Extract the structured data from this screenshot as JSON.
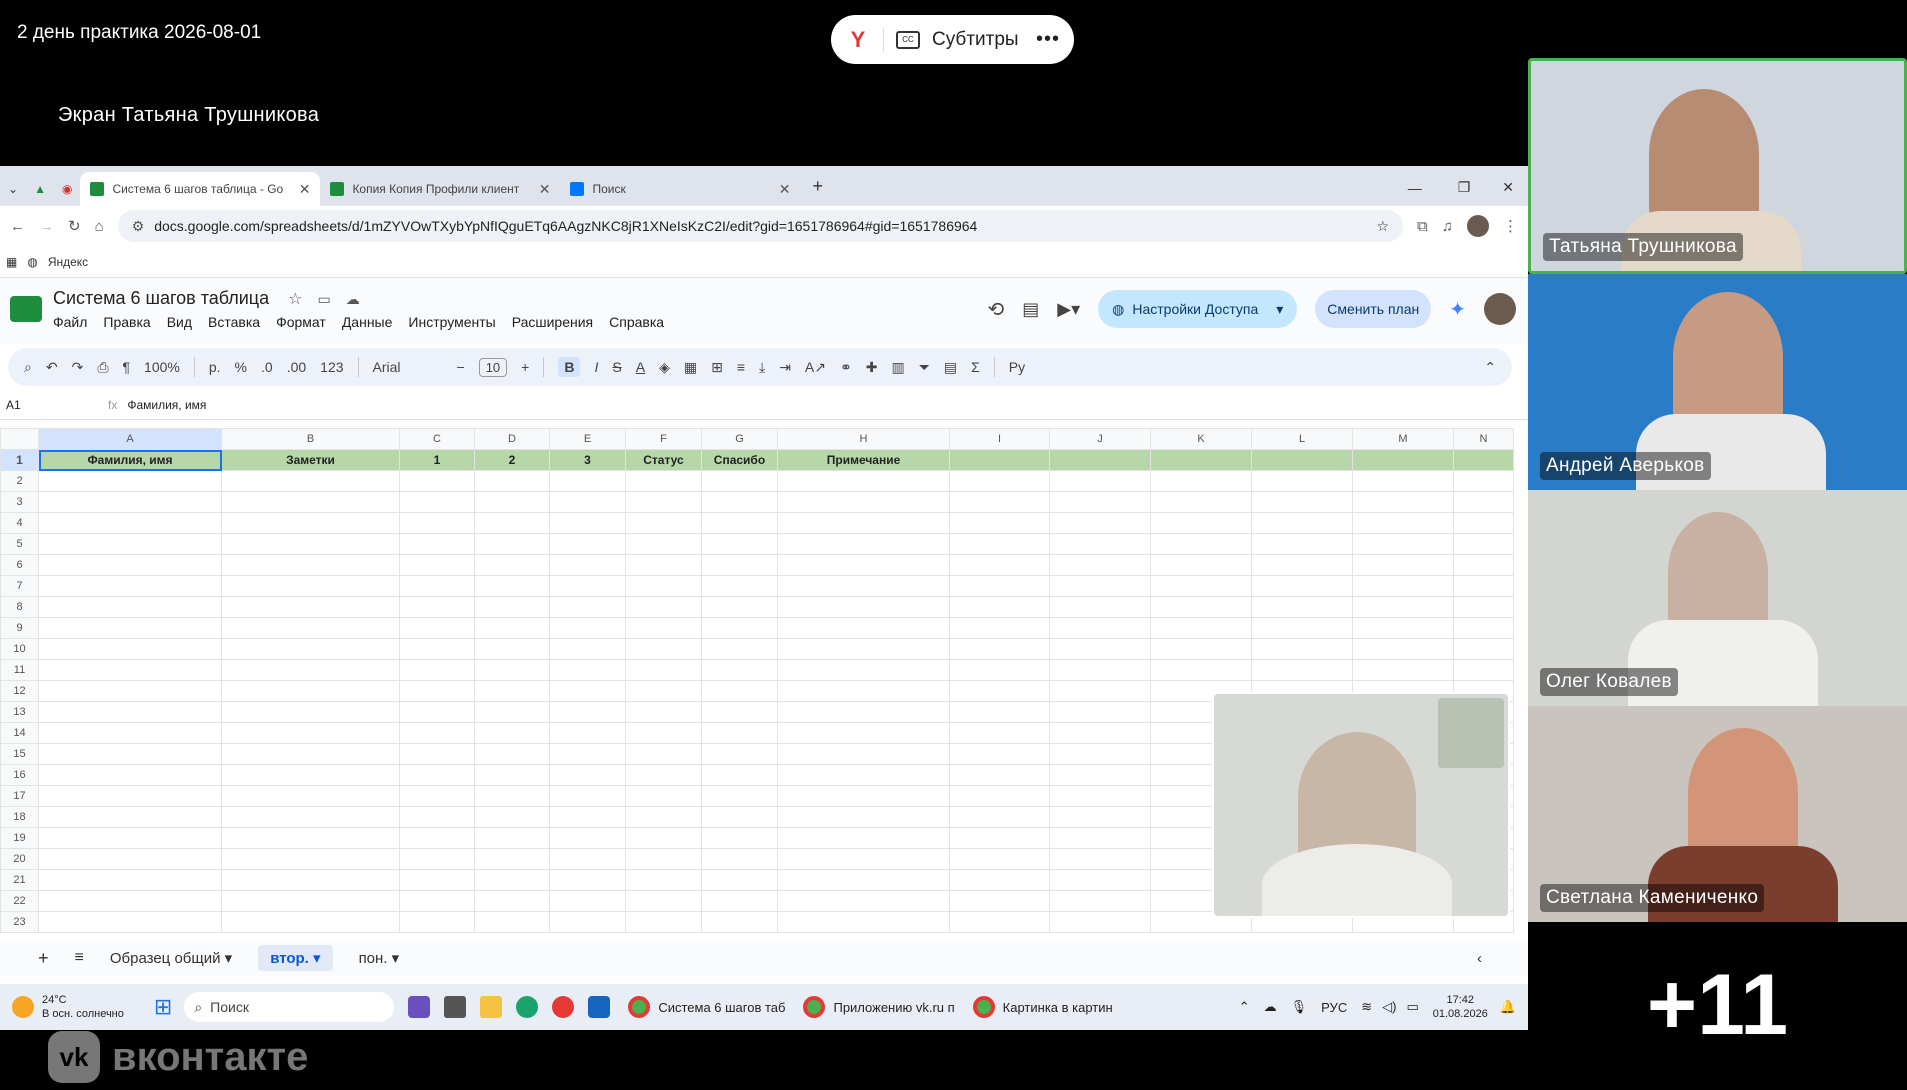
{
  "meeting": {
    "title": "2 день практика 2026-08-01",
    "screen_owner": "Экран Татьяна Трушникова",
    "subtitles_label": "Субтитры",
    "more_participants": "+11"
  },
  "browser": {
    "tabs": [
      {
        "label": "Система 6 шагов таблица - Go",
        "active": true
      },
      {
        "label": "Копия Копия Профили клиент",
        "active": false
      },
      {
        "label": "Поиск",
        "active": false
      }
    ],
    "url": "docs.google.com/spreadsheets/d/1mZYVOwTXybYpNfIQguETq6AAgzNKC8jR1XNeIsKzC2I/edit?gid=1651786964#gid=1651786964",
    "bookmark": "Яндекс"
  },
  "sheet": {
    "title": "Система 6 шагов таблица",
    "menus": [
      "Файл",
      "Правка",
      "Вид",
      "Вставка",
      "Формат",
      "Данные",
      "Инструменты",
      "Расширения",
      "Справка"
    ],
    "share_label": "Настройки Доступа",
    "plan_label": "Сменить план",
    "zoom": "100%",
    "currency": "р.",
    "percent": "%",
    "dec_less": ".0",
    "dec_more": ".00",
    "num_format": "123",
    "font": "Arial",
    "font_size": "10",
    "cell_ref": "A1",
    "formula_value": "Фамилия, имя",
    "columns": [
      "A",
      "B",
      "C",
      "D",
      "E",
      "F",
      "G",
      "H",
      "I",
      "J",
      "K",
      "L",
      "M",
      "N"
    ],
    "header_row": [
      "Фамилия, имя",
      "Заметки",
      "1",
      "2",
      "3",
      "Статус",
      "Спасибо",
      "Примечание",
      "",
      "",
      "",
      "",
      "",
      ""
    ],
    "row_numbers": [
      "1",
      "2",
      "3",
      "4",
      "5",
      "6",
      "7",
      "8",
      "9",
      "10",
      "11",
      "12",
      "13",
      "14",
      "15",
      "16",
      "17",
      "18",
      "19",
      "20",
      "21",
      "22",
      "23"
    ],
    "sheet_tabs": [
      "Образец общий",
      "втор.",
      "пон."
    ]
  },
  "taskbar": {
    "weather_temp": "24°C",
    "weather_desc": "В осн. солнечно",
    "search": "Поиск",
    "apps": [
      "Система 6 шагов таб",
      "Приложению vk.ru п",
      "Картинка в картин"
    ],
    "lang": "РУС",
    "time": "17:42",
    "date": "01.08.2026"
  },
  "participants": [
    {
      "name": "Татьяна Трушникова"
    },
    {
      "name": "Андрей Аверьков"
    },
    {
      "name": "Олег Ковалев"
    },
    {
      "name": "Светлана Камениченко"
    }
  ],
  "brand": "вконтакте"
}
